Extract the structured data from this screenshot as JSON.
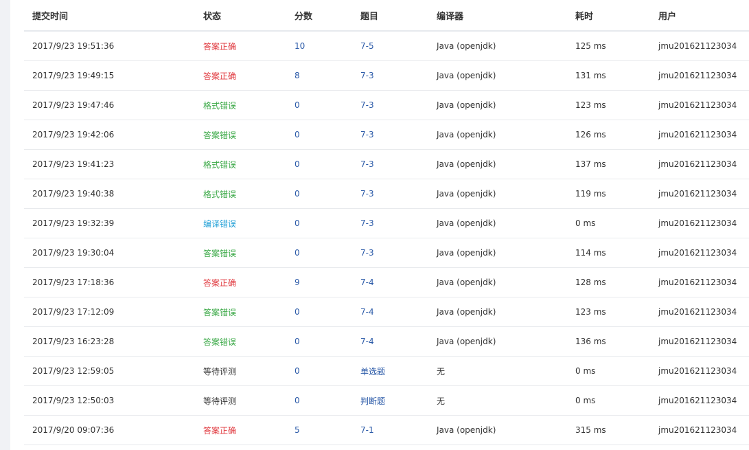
{
  "table": {
    "headers": {
      "time": "提交时间",
      "status": "状态",
      "score": "分数",
      "problem": "题目",
      "compiler": "编译器",
      "duration": "耗时",
      "user": "用户"
    },
    "status_colors": {
      "答案正确": "#e0383e",
      "格式错误": "#39a845",
      "答案错误": "#39a845",
      "编译错误": "#1f9fd6",
      "等待评测": "#333333"
    },
    "rows": [
      {
        "time": "2017/9/23 19:51:36",
        "status": "答案正确",
        "score": "10",
        "problem": "7-5",
        "compiler": "Java (openjdk)",
        "duration": "125 ms",
        "user": "jmu201621123034"
      },
      {
        "time": "2017/9/23 19:49:15",
        "status": "答案正确",
        "score": "8",
        "problem": "7-3",
        "compiler": "Java (openjdk)",
        "duration": "131 ms",
        "user": "jmu201621123034"
      },
      {
        "time": "2017/9/23 19:47:46",
        "status": "格式错误",
        "score": "0",
        "problem": "7-3",
        "compiler": "Java (openjdk)",
        "duration": "123 ms",
        "user": "jmu201621123034"
      },
      {
        "time": "2017/9/23 19:42:06",
        "status": "答案错误",
        "score": "0",
        "problem": "7-3",
        "compiler": "Java (openjdk)",
        "duration": "126 ms",
        "user": "jmu201621123034"
      },
      {
        "time": "2017/9/23 19:41:23",
        "status": "格式错误",
        "score": "0",
        "problem": "7-3",
        "compiler": "Java (openjdk)",
        "duration": "137 ms",
        "user": "jmu201621123034"
      },
      {
        "time": "2017/9/23 19:40:38",
        "status": "格式错误",
        "score": "0",
        "problem": "7-3",
        "compiler": "Java (openjdk)",
        "duration": "119 ms",
        "user": "jmu201621123034"
      },
      {
        "time": "2017/9/23 19:32:39",
        "status": "编译错误",
        "score": "0",
        "problem": "7-3",
        "compiler": "Java (openjdk)",
        "duration": "0 ms",
        "user": "jmu201621123034"
      },
      {
        "time": "2017/9/23 19:30:04",
        "status": "答案错误",
        "score": "0",
        "problem": "7-3",
        "compiler": "Java (openjdk)",
        "duration": "114 ms",
        "user": "jmu201621123034"
      },
      {
        "time": "2017/9/23 17:18:36",
        "status": "答案正确",
        "score": "9",
        "problem": "7-4",
        "compiler": "Java (openjdk)",
        "duration": "128 ms",
        "user": "jmu201621123034"
      },
      {
        "time": "2017/9/23 17:12:09",
        "status": "答案错误",
        "score": "0",
        "problem": "7-4",
        "compiler": "Java (openjdk)",
        "duration": "123 ms",
        "user": "jmu201621123034"
      },
      {
        "time": "2017/9/23 16:23:28",
        "status": "答案错误",
        "score": "0",
        "problem": "7-4",
        "compiler": "Java (openjdk)",
        "duration": "136 ms",
        "user": "jmu201621123034"
      },
      {
        "time": "2017/9/23 12:59:05",
        "status": "等待评测",
        "score": "0",
        "problem": "单选题",
        "compiler": "无",
        "duration": "0 ms",
        "user": "jmu201621123034"
      },
      {
        "time": "2017/9/23 12:50:03",
        "status": "等待评测",
        "score": "0",
        "problem": "判断题",
        "compiler": "无",
        "duration": "0 ms",
        "user": "jmu201621123034"
      },
      {
        "time": "2017/9/20 09:07:36",
        "status": "答案正确",
        "score": "5",
        "problem": "7-1",
        "compiler": "Java (openjdk)",
        "duration": "315 ms",
        "user": "jmu201621123034"
      }
    ]
  }
}
